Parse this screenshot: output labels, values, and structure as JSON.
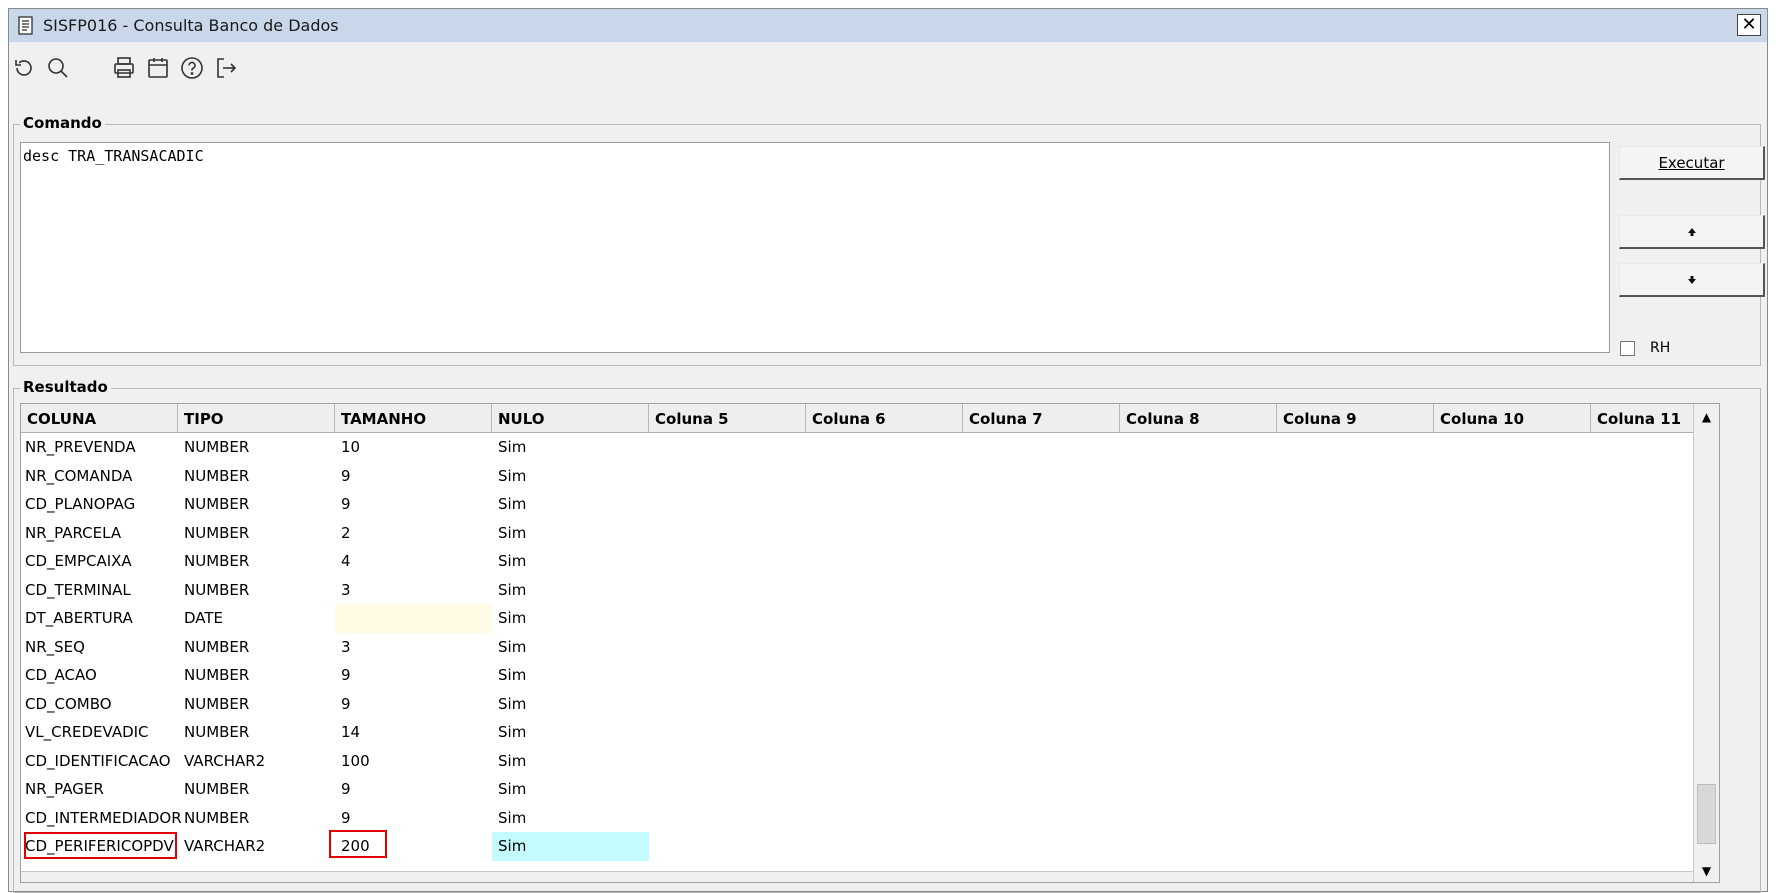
{
  "window": {
    "title": "SISFP016 - Consulta Banco de Dados",
    "close_label": "✕"
  },
  "toolbar": {
    "icons": [
      "undo-icon",
      "search-icon",
      "print-icon",
      "calendar-icon",
      "help-icon",
      "exit-icon"
    ]
  },
  "comando": {
    "label": "Comando",
    "text": "desc TRA_TRANSACADIC",
    "executar_label": "Executar",
    "up_label": "🠉",
    "down_label": "🠋",
    "rh_label": "RH",
    "rh_checked": false
  },
  "resultado": {
    "label": "Resultado",
    "columns": [
      "COLUNA",
      "TIPO",
      "TAMANHO",
      "NULO",
      "Coluna 5",
      "Coluna 6",
      "Coluna 7",
      "Coluna 8",
      "Coluna 9",
      "Coluna 10",
      "Coluna 11"
    ],
    "rows": [
      [
        "NR_PREVENDA",
        "NUMBER",
        "10",
        "Sim"
      ],
      [
        "NR_COMANDA",
        "NUMBER",
        "9",
        "Sim"
      ],
      [
        "CD_PLANOPAG",
        "NUMBER",
        "9",
        "Sim"
      ],
      [
        "NR_PARCELA",
        "NUMBER",
        "2",
        "Sim"
      ],
      [
        "CD_EMPCAIXA",
        "NUMBER",
        "4",
        "Sim"
      ],
      [
        "CD_TERMINAL",
        "NUMBER",
        "3",
        "Sim"
      ],
      [
        "DT_ABERTURA",
        "DATE",
        "",
        "Sim"
      ],
      [
        "NR_SEQ",
        "NUMBER",
        "3",
        "Sim"
      ],
      [
        "CD_ACAO",
        "NUMBER",
        "9",
        "Sim"
      ],
      [
        "CD_COMBO",
        "NUMBER",
        "9",
        "Sim"
      ],
      [
        "VL_CREDEVADIC",
        "NUMBER",
        "14",
        "Sim"
      ],
      [
        "CD_IDENTIFICACAO",
        "VARCHAR2",
        "100",
        "Sim"
      ],
      [
        "NR_PAGER",
        "NUMBER",
        "9",
        "Sim"
      ],
      [
        "CD_INTERMEDIADOR",
        "NUMBER",
        "9",
        "Sim"
      ],
      [
        "CD_PERIFERICOPDV",
        "VARCHAR2",
        "200",
        "Sim"
      ]
    ],
    "scroll_up": "▲",
    "scroll_down": "▼"
  },
  "colors": {
    "highlight_yellow": "#fffbe4",
    "highlight_cyan": "#c4fbfc",
    "annotation_red": "#e00000"
  }
}
